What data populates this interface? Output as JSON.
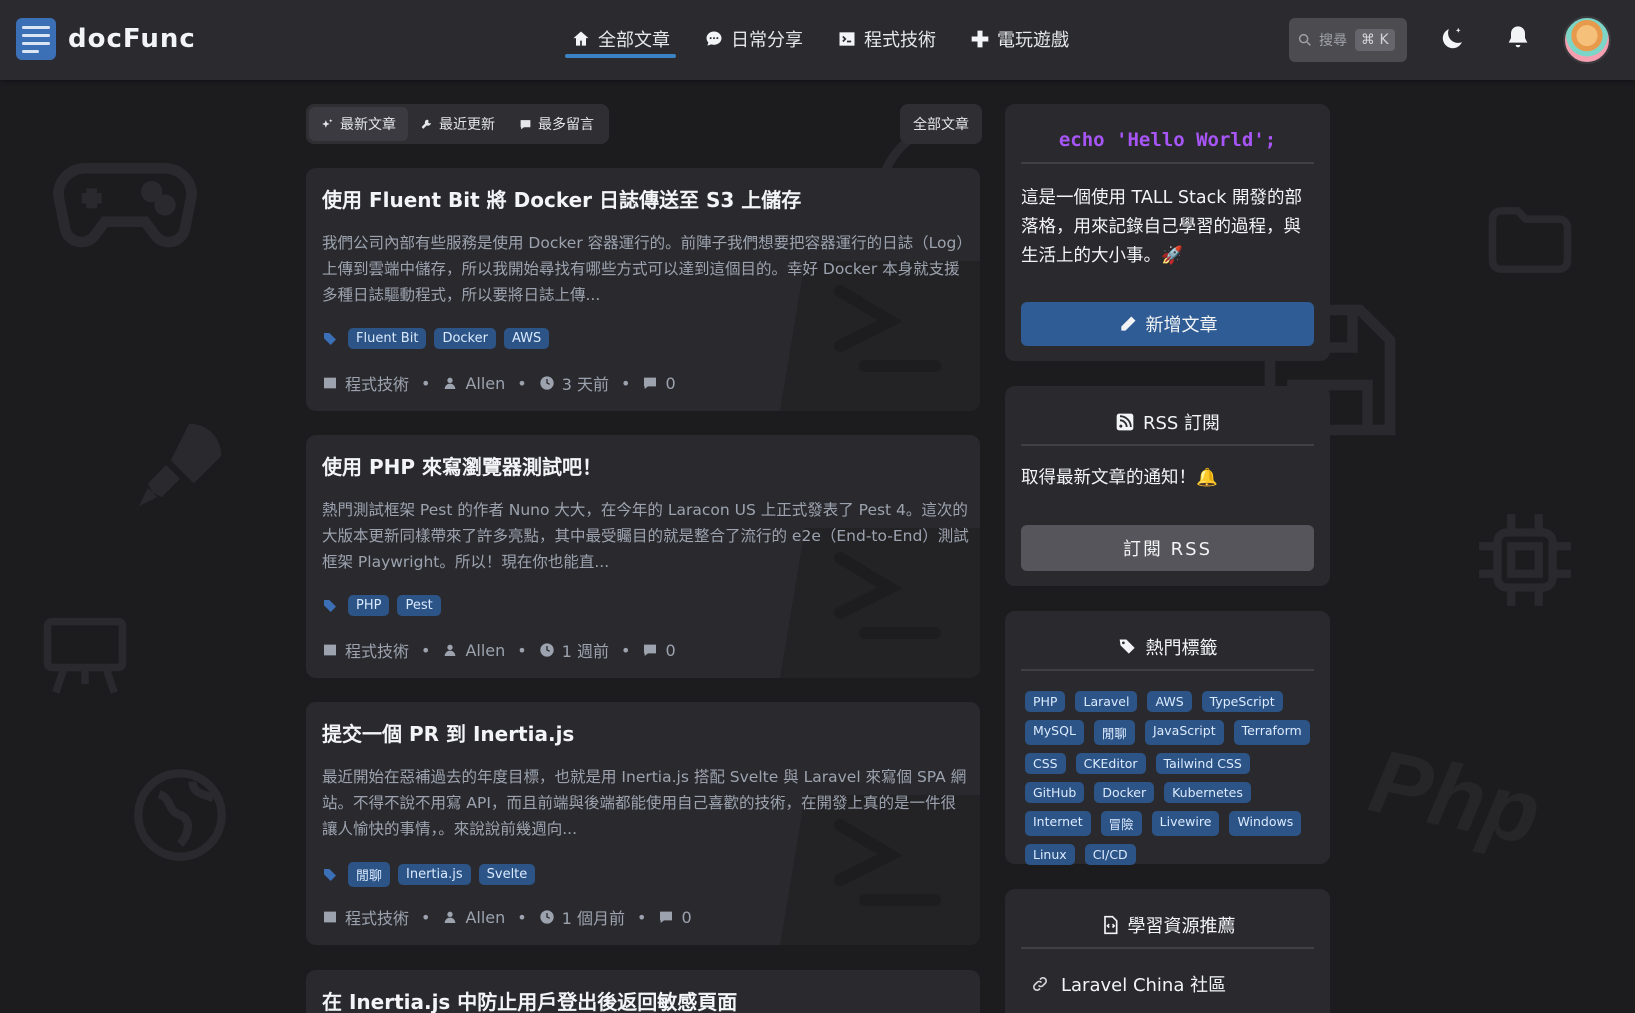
{
  "app": {
    "name": "docFunc"
  },
  "nav": [
    {
      "label": "全部文章",
      "icon": "home-icon",
      "active": true
    },
    {
      "label": "日常分享",
      "icon": "chat-icon",
      "active": false
    },
    {
      "label": "程式技術",
      "icon": "terminal-icon",
      "active": false
    },
    {
      "label": "電玩遊戲",
      "icon": "gamepad-icon",
      "active": false
    }
  ],
  "search": {
    "placeholder": "搜尋",
    "shortcut": "⌘ K"
  },
  "tabs": [
    {
      "label": "最新文章",
      "icon": "sparkles-icon",
      "active": true
    },
    {
      "label": "最近更新",
      "icon": "wrench-icon",
      "active": false
    },
    {
      "label": "最多留言",
      "icon": "comment-icon",
      "active": false
    }
  ],
  "filter": {
    "label": "全部文章"
  },
  "posts": [
    {
      "title": "使用 Fluent Bit 將 Docker 日誌傳送至 S3 上儲存",
      "excerpt": "我們公司內部有些服務是使用 Docker 容器運行的。前陣子我們想要把容器運行的日誌（Log）上傳到雲端中儲存，所以我開始尋找有哪些方式可以達到這個目的。幸好 Docker 本身就支援多種日誌驅動程式，所以要將日誌上傳...",
      "tags": [
        "Fluent Bit",
        "Docker",
        "AWS"
      ],
      "category": "程式技術",
      "author": "Allen",
      "time": "3 天前",
      "comments": "0"
    },
    {
      "title": "使用 PHP 來寫瀏覽器測試吧！",
      "excerpt": "熱門測試框架 Pest 的作者 Nuno 大大，在今年的 Laracon US 上正式發表了 Pest 4。這次的大版本更新同樣帶來了許多亮點，其中最受矚目的就是整合了流行的 e2e（End-to-End）測試框架 Playwright。所以！現在你也能直...",
      "tags": [
        "PHP",
        "Pest"
      ],
      "category": "程式技術",
      "author": "Allen",
      "time": "1 週前",
      "comments": "0"
    },
    {
      "title": "提交一個 PR 到 Inertia.js",
      "excerpt": "最近開始在惡補過去的年度目標，也就是用 Inertia.js 搭配 Svelte 與 Laravel 來寫個 SPA 網站。不得不說不用寫 API，而且前端與後端都能使用自己喜歡的技術，在開發上真的是一件很讓人愉快的事情，。來說說前幾週向...",
      "tags": [
        "閒聊",
        "Inertia.js",
        "Svelte"
      ],
      "category": "程式技術",
      "author": "Allen",
      "time": "1 個月前",
      "comments": "0"
    },
    {
      "title": "在 Inertia.js 中防止用戶登出後返回敏感頁面"
    }
  ],
  "sidebar": {
    "intro": {
      "echo": "echo 'Hello World';",
      "text": "這是一個使用 TALL Stack 開發的部落格，用來記錄自己學習的過程，與生活上的大小事。🚀",
      "button": "新增文章"
    },
    "rss": {
      "title": "RSS 訂閱",
      "text": "取得最新文章的通知！🔔",
      "button": "訂閱 RSS"
    },
    "tags": {
      "title": "熱門標籤",
      "items": [
        "PHP",
        "Laravel",
        "AWS",
        "TypeScript",
        "MySQL",
        "閒聊",
        "JavaScript",
        "Terraform",
        "CSS",
        "CKEditor",
        "Tailwind CSS",
        "GitHub",
        "Docker",
        "Kubernetes",
        "Internet",
        "冒險",
        "Livewire",
        "Windows",
        "Linux",
        "CI/CD"
      ]
    },
    "resources": {
      "title": "學習資源推薦",
      "items": [
        "Laravel China 社區"
      ]
    }
  },
  "colors": {
    "accent": "#2f5c94",
    "tag_bg": "#2c5487",
    "echo": "#a855f7",
    "bg": "#1c1c1f",
    "card": "#2a2a2e"
  }
}
